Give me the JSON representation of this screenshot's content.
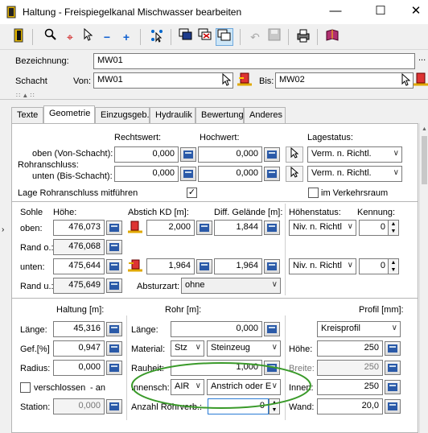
{
  "window": {
    "title": "Haltung - Freispiegelkanal Mischwasser bearbeiten",
    "minimize": "—",
    "maximize": "☐",
    "close": "✕"
  },
  "header": {
    "bezeichnung_label": "Bezeichnung:",
    "bezeichnung_value": "MW01",
    "schacht_label": "Schacht",
    "von_label": "Von:",
    "von_value": "MW01",
    "bis_label": "Bis:",
    "bis_value": "MW02",
    "more": "..."
  },
  "tabs": [
    {
      "label": "Texte"
    },
    {
      "label": "Geometrie"
    },
    {
      "label": "Einzugsgeb."
    },
    {
      "label": "Hydraulik"
    },
    {
      "label": "Bewertung"
    },
    {
      "label": "Anderes"
    }
  ],
  "rohranschluss": {
    "rechtswert_label": "Rechtswert:",
    "hochwert_label": "Hochwert:",
    "lagestatus_label": "Lagestatus:",
    "oben_label": "oben (Von-Schacht):",
    "rohranschluss_label": "Rohranschluss:",
    "unten_label": "unten (Bis-Schacht):",
    "oben_rechts": "0,000",
    "oben_hoch": "0,000",
    "unten_rechts": "0,000",
    "unten_hoch": "0,000",
    "oben_status": "Verm. n. Richtl.",
    "unten_status": "Verm. n. Richtl.",
    "mitfuehren_label": "Lage Rohranschluss mitführen",
    "mitfuehren_checked": "✓",
    "verkehrsraum_label": "im Verkehrsraum"
  },
  "sohle": {
    "sohle_label": "Sohle",
    "hoehe_label": "Höhe:",
    "abstich_label": "Abstich KD [m]:",
    "diff_label": "Diff. Gelände [m]:",
    "hoehenstatus_label": "Höhenstatus:",
    "kennung_label": "Kennung:",
    "oben_label": "oben:",
    "oben_hoehe": "476,073",
    "oben_abstich": "2,000",
    "oben_diff": "1,844",
    "oben_status": "Niv. n. Richtl",
    "oben_kennung": "0",
    "rando_label": "Rand o.:",
    "rando_value": "476,068",
    "unten_label": "unten:",
    "unten_hoehe": "475,644",
    "unten_abstich": "1,964",
    "unten_diff": "1,964",
    "unten_status": "Niv. n. Richtl",
    "unten_kennung": "0",
    "randu_label": "Rand u.:",
    "randu_value": "475,649",
    "absturzart_label": "Absturzart:",
    "absturzart_value": "ohne"
  },
  "haltung": {
    "title": "Haltung [m]:",
    "laenge_label": "Länge:",
    "laenge_value": "45,316",
    "gef_label": "Gef.[%]",
    "gef_value": "0,947",
    "radius_label": "Radius:",
    "radius_value": "0,000",
    "verschlossen_label": "verschlossen",
    "an_label": "- an",
    "station_label": "Station:",
    "station_value": "0,000"
  },
  "rohr": {
    "title": "Rohr [m]:",
    "laenge_label": "Länge:",
    "laenge_value": "0,000",
    "material_label": "Material:",
    "material_code": "Stz",
    "material_name": "Steinzeug",
    "rauheit_label": "Rauheit:",
    "rauheit_value": "1,000",
    "innensch_label": "Innensch:",
    "innensch_code": "AIR",
    "innensch_name": "Anstrich oder E",
    "anzahl_label": "Anzahl Rohrverb.:",
    "anzahl_value": "0"
  },
  "profil": {
    "title": "Profil [mm]:",
    "profil_value": "Kreisprofil",
    "hoehe_label": "Höhe:",
    "hoehe_value": "250",
    "breite_label": "Breite:",
    "breite_value": "250",
    "innen_label": "Innen:",
    "innen_value": "250",
    "wand_label": "Wand:",
    "wand_value": "20,0"
  },
  "colors": {
    "annotation_ellipse": "#3a9a2a",
    "active_toolbar": "#cde6f7"
  }
}
